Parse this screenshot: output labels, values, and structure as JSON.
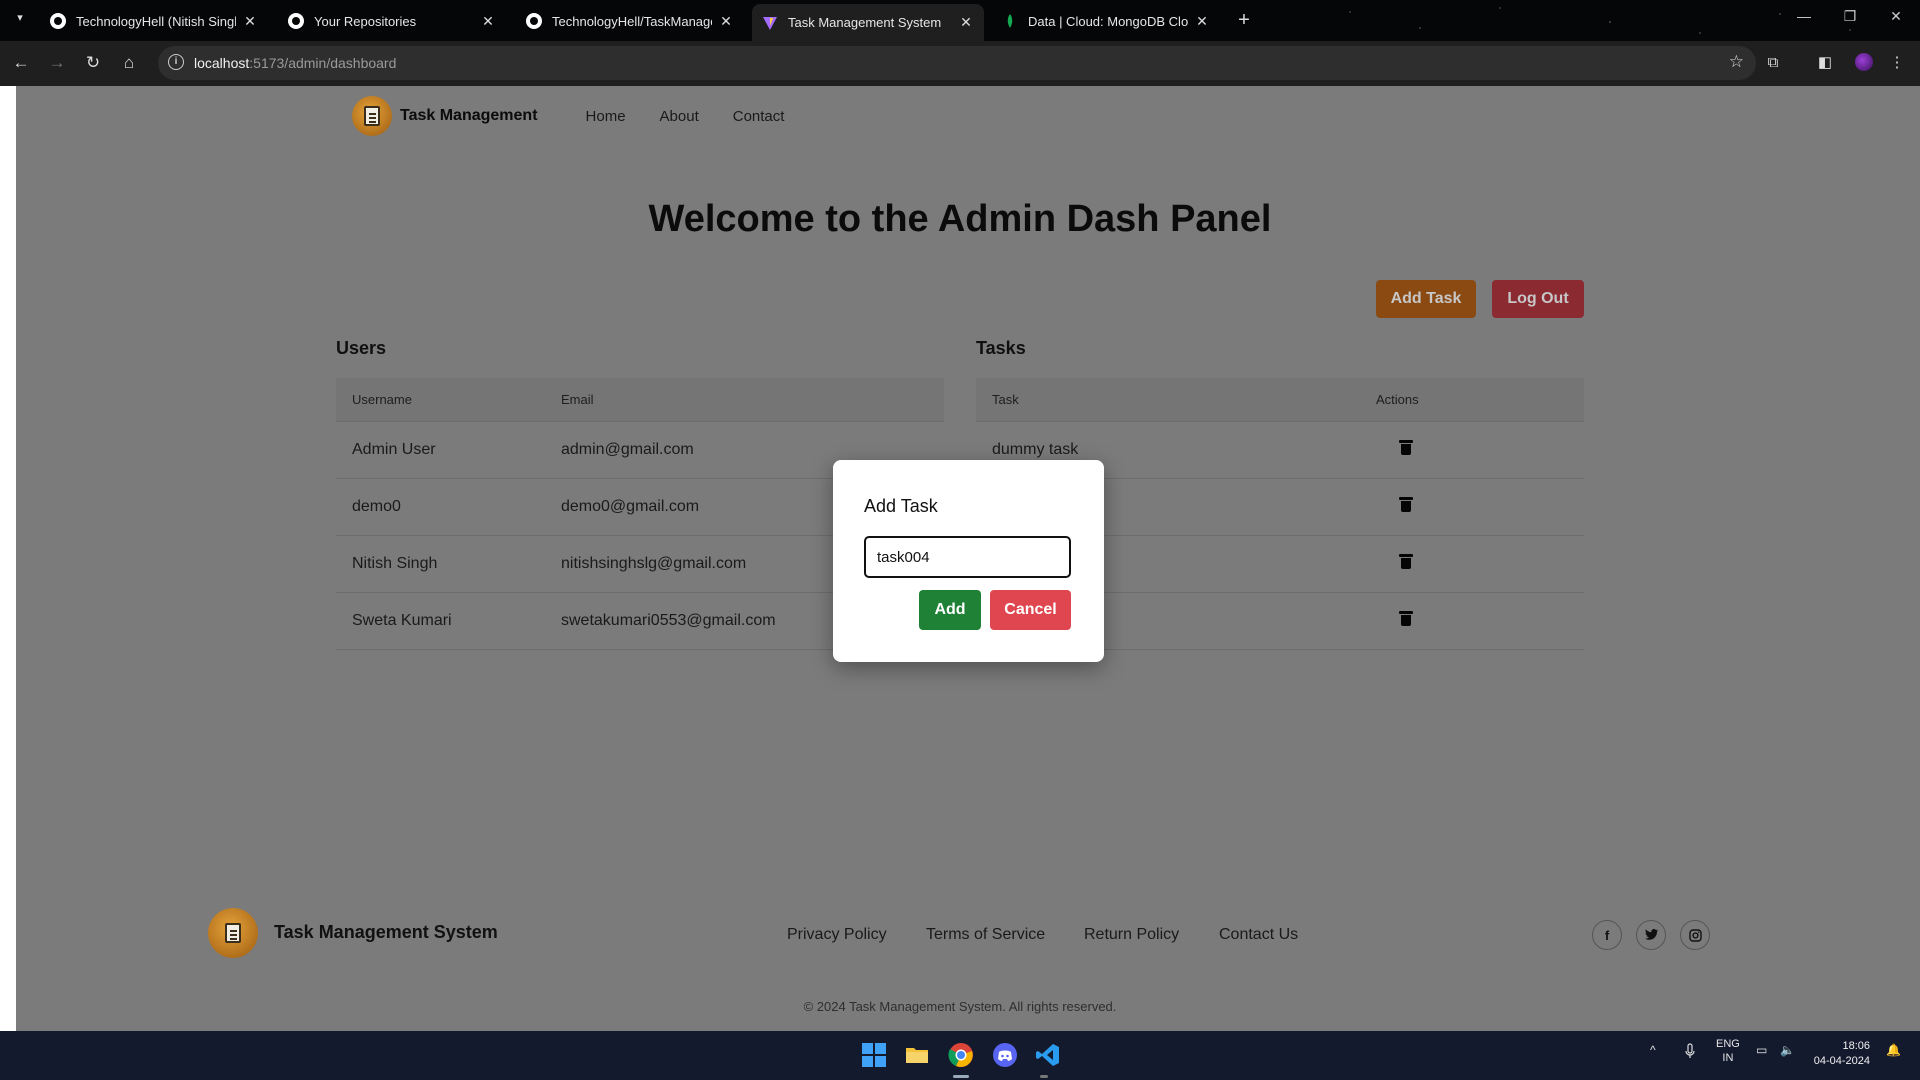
{
  "browser": {
    "tabs": [
      {
        "title": "TechnologyHell (Nitish Singh)",
        "icon": "github-icon"
      },
      {
        "title": "Your Repositories",
        "icon": "github-icon"
      },
      {
        "title": "TechnologyHell/TaskManageme",
        "icon": "github-icon"
      },
      {
        "title": "Task Management System",
        "icon": "vite-icon",
        "active": true
      },
      {
        "title": "Data | Cloud: MongoDB Cloud",
        "icon": "mongodb-leaf-icon"
      }
    ],
    "url_host": "localhost",
    "url_path": ":5173/admin/dashboard"
  },
  "page": {
    "nav": {
      "brand": "Task Management",
      "links": [
        "Home",
        "About",
        "Contact"
      ]
    },
    "heading": "Welcome to the Admin Dash Panel",
    "buttons": {
      "add_task": "Add Task",
      "log_out": "Log Out"
    },
    "users": {
      "title": "Users",
      "columns": [
        "Username",
        "Email"
      ],
      "rows": [
        [
          "Admin User",
          "admin@gmail.com"
        ],
        [
          "demo0",
          "demo0@gmail.com"
        ],
        [
          "Nitish Singh",
          "nitishsinghslg@gmail.com"
        ],
        [
          "Sweta Kumari",
          "swetakumari0553@gmail.com"
        ]
      ]
    },
    "tasks": {
      "title": "Tasks",
      "columns": [
        "Task",
        "Actions"
      ],
      "rows": [
        "dummy task",
        "",
        "",
        ""
      ]
    },
    "footer": {
      "brand": "Task Management System",
      "links": [
        "Privacy Policy",
        "Terms of Service",
        "Return Policy",
        "Contact Us"
      ],
      "social": [
        "facebook-icon",
        "twitter-icon",
        "instagram-icon"
      ],
      "copyright": "© 2024 Task Management System. All rights reserved."
    }
  },
  "modal": {
    "title": "Add Task",
    "input_value": "task004",
    "add_label": "Add",
    "cancel_label": "Cancel"
  },
  "taskbar": {
    "lang_top": "ENG",
    "lang_bottom": "IN",
    "time": "18:06",
    "date": "04-04-2024"
  },
  "colors": {
    "add_task_button": "#8a4a12",
    "log_out_button": "#8c2a31",
    "modal_add_button": "#1e8135",
    "modal_cancel_button": "#e0464f",
    "overlay_background": "#7b7b7b"
  }
}
